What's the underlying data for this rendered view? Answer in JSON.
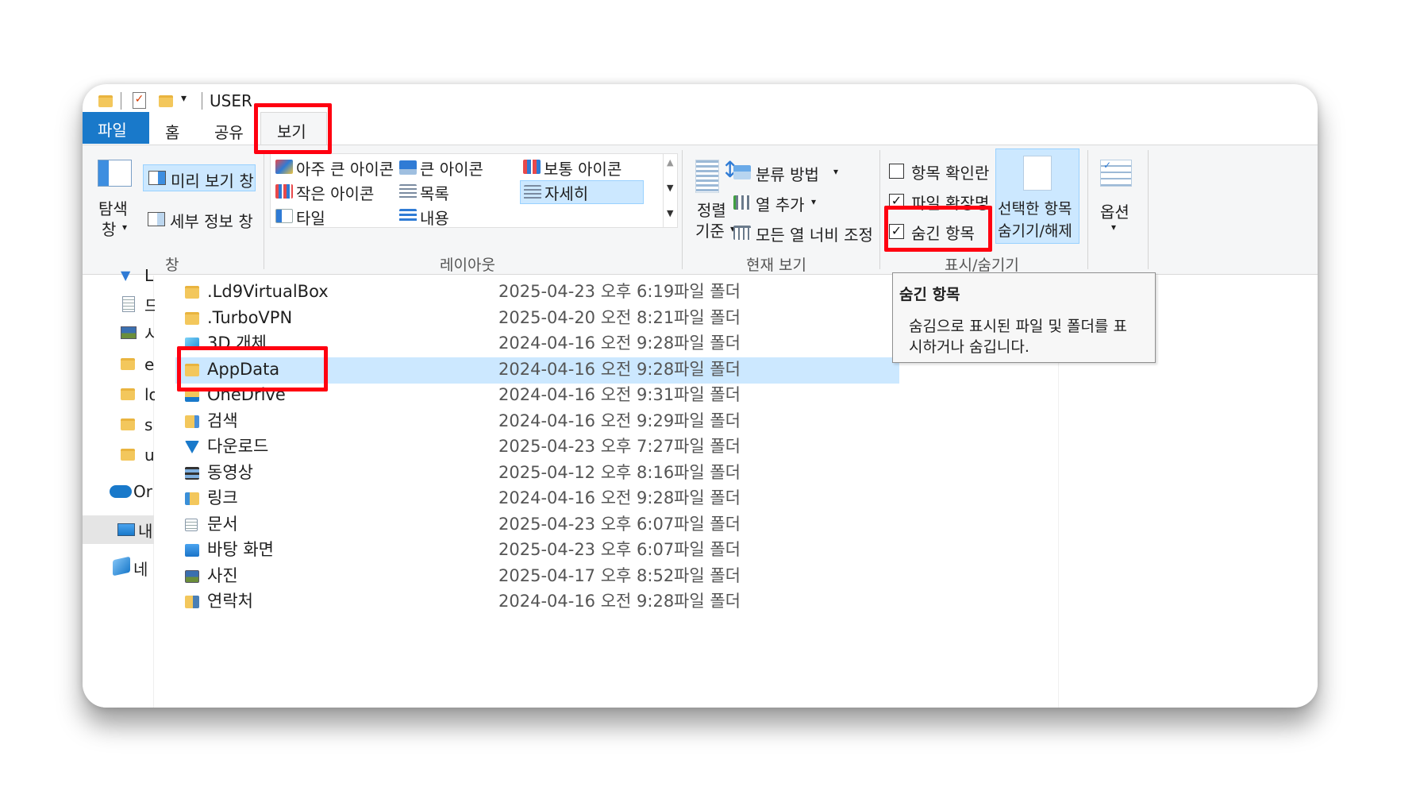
{
  "window": {
    "title": "USER"
  },
  "tabs": [
    {
      "label": "파일"
    },
    {
      "label": "홈"
    },
    {
      "label": "공유"
    },
    {
      "label": "보기"
    }
  ],
  "ribbon": {
    "pane_group": {
      "nav_pane": "탐색",
      "nav_pane_2": "창",
      "preview": "미리 보기 창",
      "details": "세부 정보 창",
      "label": "창"
    },
    "layout_group": {
      "label": "레이아웃",
      "items": [
        "아주 큰 아이콘",
        "큰 아이콘",
        "보통 아이콘",
        "작은 아이콘",
        "목록",
        "자세히",
        "타일",
        "내용"
      ]
    },
    "current_view": {
      "label": "현재 보기",
      "sort_1": "정렬",
      "sort_2": "기준",
      "group_by": "분류 방법",
      "add_column": "열 추가",
      "fit_columns": "모든 열 너비 조정"
    },
    "show_hide": {
      "label": "표시/숨기기",
      "item_checkboxes": "항목 확인란",
      "file_extensions": "파일 확장명",
      "hidden_items": "숨긴 항목",
      "hide_selected_1": "선택한 항목",
      "hide_selected_2": "숨기기/해제"
    },
    "options": {
      "label": "옵션"
    }
  },
  "tooltip": {
    "title": "숨긴 항목",
    "line1": "숨김으로 표시된 파일 및 폴더를 표",
    "line2": "시하거나 숨깁니다."
  },
  "sidebar": {
    "items": [
      "L",
      "드",
      "시",
      "e",
      "lo",
      "s",
      "u",
      "Or",
      "내",
      "네"
    ]
  },
  "files": [
    {
      "name": ".Ld9VirtualBox",
      "date": "2025-04-23 오후 6:19",
      "type": "파일 폴더",
      "icon": "folder-icon"
    },
    {
      "name": ".TurboVPN",
      "date": "2025-04-20 오전 8:21",
      "type": "파일 폴더",
      "icon": "folder-icon"
    },
    {
      "name": "3D 개체",
      "date": "2024-04-16 오전 9:28",
      "type": "파일 폴더",
      "icon": "cube-icon"
    },
    {
      "name": "AppData",
      "date": "2024-04-16 오전 9:28",
      "type": "파일 폴더",
      "icon": "folder-icon"
    },
    {
      "name": "OneDrive",
      "date": "2024-04-16 오전 9:31",
      "type": "파일 폴더",
      "icon": "cloud-folder-icon"
    },
    {
      "name": "검색",
      "date": "2024-04-16 오전 9:29",
      "type": "파일 폴더",
      "icon": "search-folder-icon"
    },
    {
      "name": "다운로드",
      "date": "2025-04-23 오후 7:27",
      "type": "파일 폴더",
      "icon": "download-icon"
    },
    {
      "name": "동영상",
      "date": "2025-04-12 오후 8:16",
      "type": "파일 폴더",
      "icon": "film-icon"
    },
    {
      "name": "링크",
      "date": "2024-04-16 오전 9:28",
      "type": "파일 폴더",
      "icon": "link-folder-icon"
    },
    {
      "name": "문서",
      "date": "2025-04-23 오후 6:07",
      "type": "파일 폴더",
      "icon": "document-icon"
    },
    {
      "name": "바탕 화면",
      "date": "2025-04-23 오후 6:07",
      "type": "파일 폴더",
      "icon": "desktop-icon"
    },
    {
      "name": "사진",
      "date": "2025-04-17 오후 8:52",
      "type": "파일 폴더",
      "icon": "picture-icon"
    },
    {
      "name": "연락처",
      "date": "2024-04-16 오전 9:28",
      "type": "파일 폴더",
      "icon": "contacts-icon"
    }
  ],
  "colors": {
    "accent": "#1979ca",
    "highlight": "#ff0010",
    "selection": "#cce8ff"
  }
}
